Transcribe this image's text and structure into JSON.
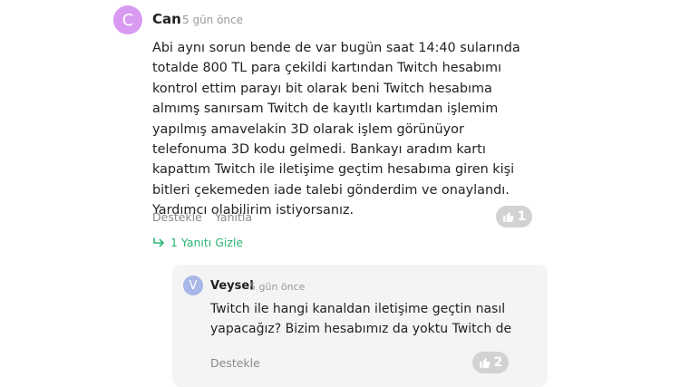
{
  "comment": {
    "avatar_letter": "C",
    "avatar_color": "#d99af2",
    "author": "Can",
    "time": "5 gün önce",
    "text": "Abi aynı sorun bende de var bugün saat 14:40 sularında totalde 800 TL para çekildi kartından Twitch hesabımı kontrol ettim parayı bit olarak beni Twitch hesabıma almımş sanırsam Twitch de kayıtlı kartımdan işlemim yapılmış amavelakin 3D olarak işlem görünüyor telefonuma 3D kodu gelmedi. Bankayı aradım kartı kapattım Twitch ile iletişime geçtim hesabıma giren kişi bitleri çekemeden iade talebi gönderdim ve onaylandı. Yardımcı olabilirim istiyorsanız.",
    "support_label": "Destekle",
    "reply_label": "Yanıtla",
    "like_count": "1",
    "toggle_label": "1 Yanıtı Gizle"
  },
  "reply": {
    "avatar_letter": "V",
    "avatar_color": "#a8b6e8",
    "author": "Veysel",
    "time": "5 gün önce",
    "text": "Twitch ile hangi kanaldan iletişime geçtin nasıl yapacağız? Bizim hesabımız da yoktu Twitch de",
    "support_label": "Destekle",
    "like_count": "2"
  },
  "colors": {
    "accent_green": "#2bb673",
    "like_pill": "#d2d2d2",
    "reply_bg": "#f4f4f4"
  }
}
